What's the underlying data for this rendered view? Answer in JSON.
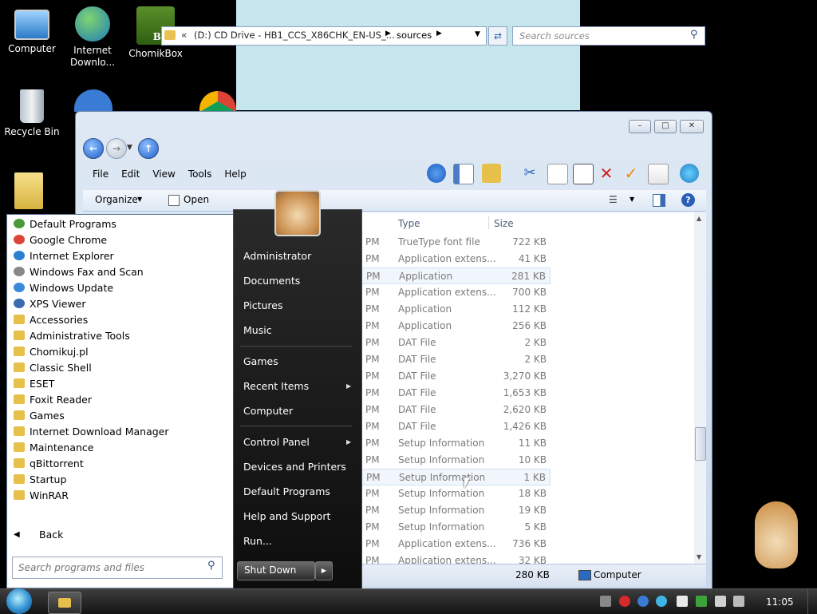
{
  "desktop": {
    "icons": [
      {
        "label": "Computer"
      },
      {
        "label": "Internet Downlo..."
      },
      {
        "label": "ChomikBox"
      },
      {
        "label": "Recycle Bin"
      }
    ],
    "chomik_badge": "Box"
  },
  "explorer": {
    "address": {
      "prefix": "«",
      "crumb1": "(D:) CD Drive - HB1_CCS_X86CHK_EN-US_...",
      "crumb2": "sources"
    },
    "search_placeholder": "Search sources",
    "menu": [
      "File",
      "Edit",
      "View",
      "Tools",
      "Help"
    ],
    "commands": {
      "organize": "Organize",
      "open": "Open"
    },
    "columns": {
      "type": "Type",
      "size": "Size"
    },
    "rows": [
      {
        "time": "PM",
        "type": "TrueType font file",
        "size": "722 KB"
      },
      {
        "time": "PM",
        "type": "Application extens...",
        "size": "41 KB"
      },
      {
        "time": "PM",
        "type": "Application",
        "size": "281 KB"
      },
      {
        "time": "PM",
        "type": "Application extens...",
        "size": "700 KB"
      },
      {
        "time": "PM",
        "type": "Application",
        "size": "112 KB"
      },
      {
        "time": "PM",
        "type": "Application",
        "size": "256 KB"
      },
      {
        "time": "PM",
        "type": "DAT File",
        "size": "2 KB"
      },
      {
        "time": "PM",
        "type": "DAT File",
        "size": "2 KB"
      },
      {
        "time": "PM",
        "type": "DAT File",
        "size": "3,270 KB"
      },
      {
        "time": "PM",
        "type": "DAT File",
        "size": "1,653 KB"
      },
      {
        "time": "PM",
        "type": "DAT File",
        "size": "2,620 KB"
      },
      {
        "time": "PM",
        "type": "DAT File",
        "size": "1,426 KB"
      },
      {
        "time": "PM",
        "type": "Setup Information",
        "size": "11 KB"
      },
      {
        "time": "PM",
        "type": "Setup Information",
        "size": "10 KB"
      },
      {
        "time": "PM",
        "type": "Setup Information",
        "size": "1 KB"
      },
      {
        "time": "PM",
        "type": "Setup Information",
        "size": "18 KB"
      },
      {
        "time": "PM",
        "type": "Setup Information",
        "size": "19 KB"
      },
      {
        "time": "PM",
        "type": "Setup Information",
        "size": "5 KB"
      },
      {
        "time": "PM",
        "type": "Application extens...",
        "size": "736 KB"
      },
      {
        "time": "PM",
        "type": "Application extens...",
        "size": "32 KB"
      }
    ],
    "status": {
      "size": "280 KB",
      "location": "Computer"
    }
  },
  "start_menu": {
    "programs": [
      {
        "label": "Default Programs",
        "icon": "default-programs-icon"
      },
      {
        "label": "Google Chrome",
        "icon": "chrome-icon"
      },
      {
        "label": "Internet Explorer",
        "icon": "ie-icon"
      },
      {
        "label": "Windows Fax and Scan",
        "icon": "fax-icon"
      },
      {
        "label": "Windows Update",
        "icon": "windows-update-icon"
      },
      {
        "label": "XPS Viewer",
        "icon": "xps-icon"
      },
      {
        "label": "Accessories",
        "icon": "folder-icon"
      },
      {
        "label": "Administrative Tools",
        "icon": "folder-icon"
      },
      {
        "label": "Chomikuj.pl",
        "icon": "folder-icon"
      },
      {
        "label": "Classic Shell",
        "icon": "folder-icon"
      },
      {
        "label": "ESET",
        "icon": "folder-icon"
      },
      {
        "label": "Foxit Reader",
        "icon": "folder-icon"
      },
      {
        "label": "Games",
        "icon": "folder-icon"
      },
      {
        "label": "Internet Download Manager",
        "icon": "folder-icon"
      },
      {
        "label": "Maintenance",
        "icon": "folder-icon"
      },
      {
        "label": "qBittorrent",
        "icon": "folder-icon"
      },
      {
        "label": "Startup",
        "icon": "folder-icon"
      },
      {
        "label": "WinRAR",
        "icon": "folder-icon"
      }
    ],
    "back": "Back",
    "search_placeholder": "Search programs and files",
    "right_items": [
      "Administrator",
      "Documents",
      "Pictures",
      "Music",
      "Games",
      "Recent Items",
      "Computer",
      "Control Panel",
      "Devices and Printers",
      "Default Programs",
      "Help and Support",
      "Run..."
    ],
    "shutdown": "Shut Down"
  },
  "taskbar": {
    "clock": "11:05"
  }
}
